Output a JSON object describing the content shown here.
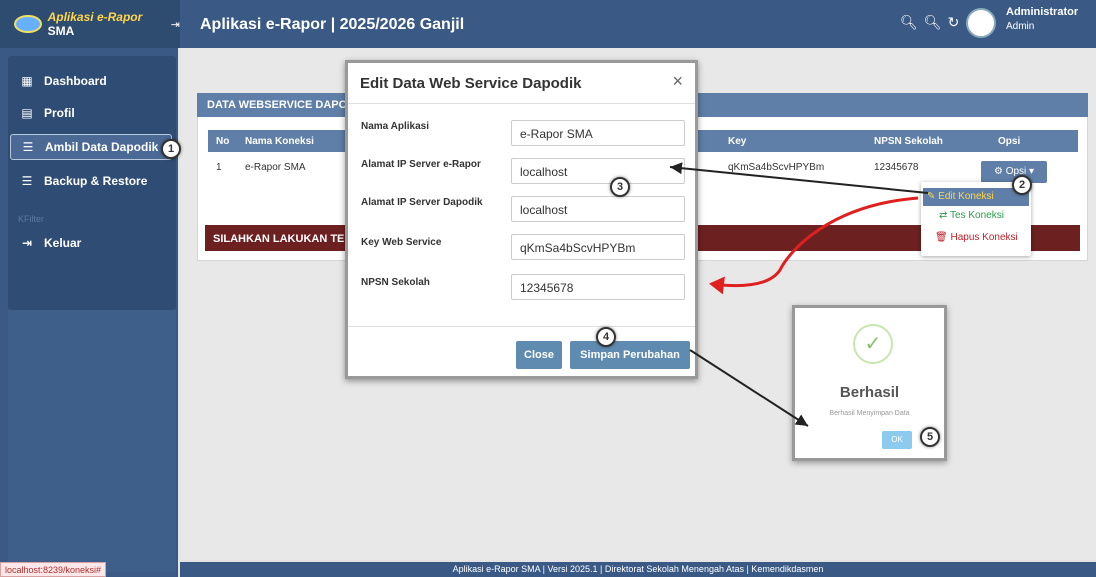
{
  "header": {
    "brand_part1": "Aplikasi e-Rapor",
    "brand_part2": "SMA",
    "pin_icon": "⇥",
    "app_title": "Aplikasi e-Rapor | 2025/2026 Ganjil",
    "icons": [
      "zoom-in-icon",
      "zoom-out-icon",
      "refresh-icon"
    ],
    "user_name": "Administrator",
    "user_role": "Admin"
  },
  "sidebar": {
    "items": [
      {
        "label": "Dashboard",
        "icon": "dashboard-icon"
      },
      {
        "label": "Profil",
        "icon": "profile-card-icon"
      },
      {
        "label": "Ambil Data Dapodik",
        "icon": "database-icon"
      },
      {
        "label": "Backup & Restore",
        "icon": "database-icon"
      },
      {
        "label": "Keluar",
        "icon": "logout-icon"
      }
    ],
    "muted_text": "KFilter"
  },
  "panel": {
    "title": "DATA WEBSERVICE DAPOI",
    "columns": {
      "no": "No",
      "nama": "Nama Koneksi",
      "key": "Key",
      "npsn": "NPSN Sekolah",
      "opsi": "Opsi"
    },
    "row": {
      "no": "1",
      "nama": "e-Rapor SMA",
      "key": "qKmSa4bScvHPYBm",
      "npsn": "12345678"
    },
    "opsi_button": "Opsi",
    "alert": "SILAHKAN LAKUKAN TE"
  },
  "dropdown": {
    "edit": "Edit Koneksi",
    "tes": "Tes Koneksi",
    "hapus": "Hapus Koneksi"
  },
  "modal": {
    "title": "Edit Data Web Service Dapodik",
    "close_x": "×",
    "fields": [
      {
        "label": "Nama Aplikasi",
        "value": "e-Rapor SMA"
      },
      {
        "label": "Alamat IP Server e-Rapor",
        "value": "localhost"
      },
      {
        "label": "Alamat IP Server Dapodik",
        "value": "localhost"
      },
      {
        "label": "Key Web Service",
        "value": "qKmSa4bScvHPYBm"
      },
      {
        "label": "NPSN Sekolah",
        "value": "12345678"
      }
    ],
    "close_button": "Close",
    "save_button": "Simpan Perubahan"
  },
  "success": {
    "title": "Berhasil",
    "text": "Berhasil Menyimpan Data",
    "ok": "OK"
  },
  "badges": [
    "1",
    "2",
    "3",
    "4",
    "5"
  ],
  "footer": {
    "text": "Aplikasi e-Rapor SMA | Versi 2025.1 | Direktorat Sekolah Menengah Atas | Kemendikdasmen",
    "status_url": "localhost:8239/koneksi#"
  },
  "colors": {
    "primary": "#3a5a85",
    "alert": "#6d2020",
    "annotation_arrow": "#e02020"
  }
}
